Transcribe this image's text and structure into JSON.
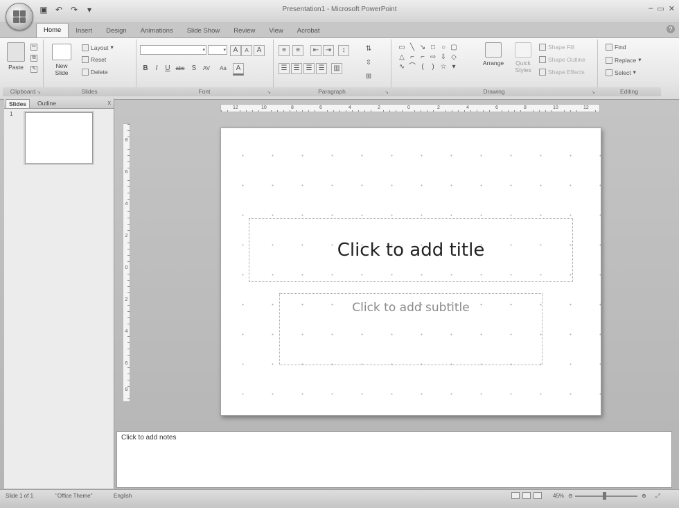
{
  "window": {
    "title": "Presentation1 - Microsoft PowerPoint",
    "controls": [
      "–",
      "▭",
      "✕"
    ]
  },
  "tabs": [
    "Home",
    "Insert",
    "Design",
    "Animations",
    "Slide Show",
    "Review",
    "View",
    "Acrobat"
  ],
  "active_tab": "Home",
  "ribbon": {
    "clipboard": {
      "label": "Clipboard",
      "paste": "Paste"
    },
    "slides": {
      "label": "Slides",
      "new_slide": "New Slide",
      "layout": "Layout",
      "reset": "Reset",
      "delete": "Delete"
    },
    "font": {
      "label": "Font",
      "grow": "A",
      "shrink": "A",
      "clear": "A",
      "bold": "B",
      "italic": "I",
      "underline": "U",
      "strike": "abc",
      "shadow": "S",
      "spacing": "AV",
      "case": "Aa",
      "color": "A"
    },
    "paragraph": {
      "label": "Paragraph"
    },
    "drawing": {
      "label": "Drawing",
      "arrange": "Arrange",
      "quick_styles": "Quick Styles",
      "shape_fill": "Shape Fill",
      "shape_outline": "Shape Outline",
      "shape_effects": "Shape Effects"
    },
    "editing": {
      "label": "Editing",
      "find": "Find",
      "replace": "Replace",
      "select": "Select"
    }
  },
  "left_panel": {
    "tabs": [
      "Slides",
      "Outline"
    ],
    "close": "x",
    "slide_number": "1"
  },
  "ruler": {
    "h_labels": [
      "12",
      "10",
      "8",
      "6",
      "4",
      "2",
      "0",
      "2",
      "4",
      "6",
      "8",
      "10",
      "12"
    ],
    "v_labels": [
      "8",
      "6",
      "4",
      "2",
      "0",
      "2",
      "4",
      "6",
      "8"
    ]
  },
  "slide": {
    "title_placeholder": "Click to add title",
    "subtitle_placeholder": "Click to add subtitle"
  },
  "notes": {
    "placeholder": "Click to add notes"
  },
  "status": {
    "slide": "Slide 1 of 1",
    "theme": "\"Office Theme\"",
    "language": "English",
    "zoom": "45%"
  }
}
